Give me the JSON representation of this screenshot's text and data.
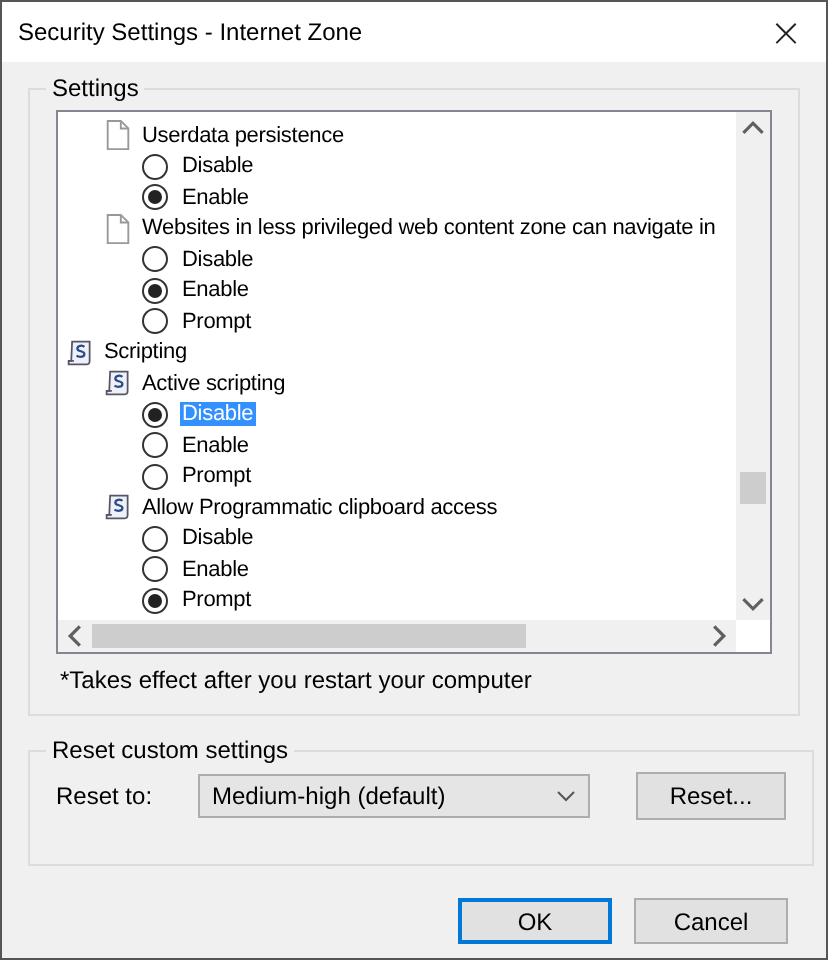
{
  "window": {
    "title": "Security Settings - Internet Zone",
    "close": "×"
  },
  "settings": {
    "legend": "Settings",
    "tree": [
      {
        "kind": "category",
        "children": [
          {
            "kind": "page",
            "label": "Userdata persistence",
            "children": [
              {
                "kind": "option",
                "label": "Disable",
                "selected": false,
                "focused": false
              },
              {
                "kind": "option",
                "label": "Enable",
                "selected": true,
                "focused": false
              }
            ]
          },
          {
            "kind": "page",
            "label": "Websites in less privileged web content zone can navigate in",
            "children": [
              {
                "kind": "option",
                "label": "Disable",
                "selected": false,
                "focused": false
              },
              {
                "kind": "option",
                "label": "Enable",
                "selected": true,
                "focused": false
              },
              {
                "kind": "option",
                "label": "Prompt",
                "selected": false,
                "focused": false
              }
            ]
          }
        ]
      },
      {
        "kind": "category",
        "label": "Scripting",
        "children": [
          {
            "kind": "script",
            "label": "Active scripting",
            "children": [
              {
                "kind": "option",
                "label": "Disable",
                "selected": true,
                "focused": true
              },
              {
                "kind": "option",
                "label": "Enable",
                "selected": false,
                "focused": false
              },
              {
                "kind": "option",
                "label": "Prompt",
                "selected": false,
                "focused": false
              }
            ]
          },
          {
            "kind": "script",
            "label": "Allow Programmatic clipboard access",
            "children": [
              {
                "kind": "option",
                "label": "Disable",
                "selected": false,
                "focused": false
              },
              {
                "kind": "option",
                "label": "Enable",
                "selected": false,
                "focused": false
              },
              {
                "kind": "option",
                "label": "Prompt",
                "selected": true,
                "focused": false
              }
            ]
          }
        ]
      }
    ],
    "note": "*Takes effect after you restart your computer"
  },
  "reset": {
    "legend": "Reset custom settings",
    "label": "Reset to:",
    "value": "Medium-high (default)",
    "button": "Reset..."
  },
  "buttons": [
    {
      "label": "OK",
      "default": true
    },
    {
      "label": "Cancel",
      "default": false
    }
  ]
}
